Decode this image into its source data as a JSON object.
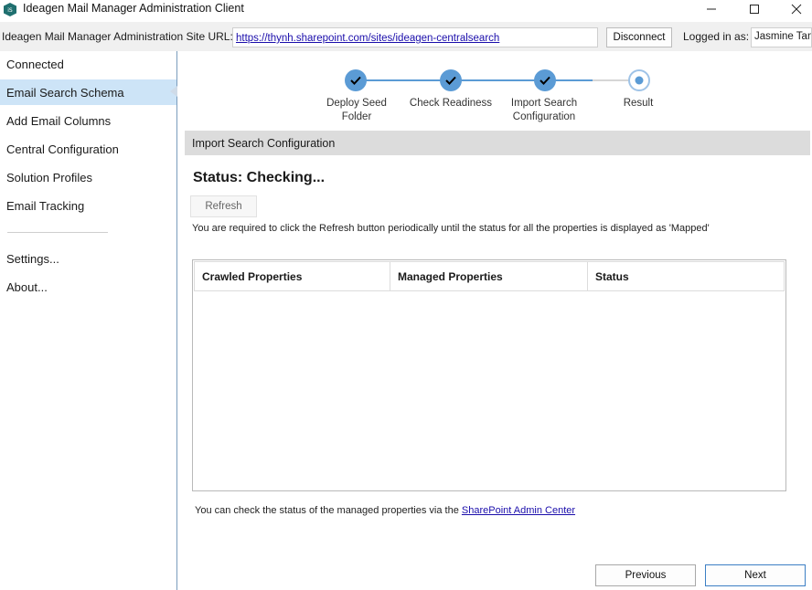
{
  "window": {
    "title": "Ideagen Mail Manager Administration Client",
    "minimize_icon": "minimize-icon",
    "maximize_icon": "maximize-icon",
    "close_icon": "close-icon",
    "app_icon": "ideagen-app-icon",
    "app_icon_color": "#1f6f6f"
  },
  "urlbar": {
    "label": "Ideagen Mail Manager Administration Site URL:",
    "url": "https://thynh.sharepoint.com/sites/ideagen-centralsearch",
    "disconnect_label": "Disconnect",
    "logged_in_label": "Logged in as:",
    "user": "Jasmine Tang"
  },
  "sidebar": {
    "items": [
      {
        "label": "Connected",
        "selected": false
      },
      {
        "label": "Email Search Schema",
        "selected": true
      },
      {
        "label": "Add Email Columns",
        "selected": false
      },
      {
        "label": "Central Configuration",
        "selected": false
      },
      {
        "label": "Solution Profiles",
        "selected": false
      },
      {
        "label": "Email Tracking",
        "selected": false
      },
      {
        "label": "Settings...",
        "selected": false
      },
      {
        "label": "About...",
        "selected": false
      }
    ],
    "selected_color": "#cde4f7"
  },
  "wizard": {
    "steps": [
      {
        "label": "Deploy Seed\nFolder",
        "state": "done"
      },
      {
        "label": "Check Readiness",
        "state": "done"
      },
      {
        "label": "Import Search\nConfiguration",
        "state": "done"
      },
      {
        "label": "Result",
        "state": "current"
      }
    ],
    "done_color": "#5b9bd5",
    "line_color": "#5b9bd5"
  },
  "main": {
    "section_title": "Import Search Configuration",
    "status": "Status: Checking...",
    "refresh_label": "Refresh",
    "hint": "You are required to click the Refresh button periodically until the status for all the properties is displayed as 'Mapped'",
    "grid": {
      "columns": [
        "Crawled Properties",
        "Managed Properties",
        "Status"
      ],
      "rows": []
    },
    "footer_text": "You can check the status of the managed properties via the ",
    "footer_link": "SharePoint Admin Center",
    "previous_label": "Previous",
    "next_label": "Next"
  }
}
